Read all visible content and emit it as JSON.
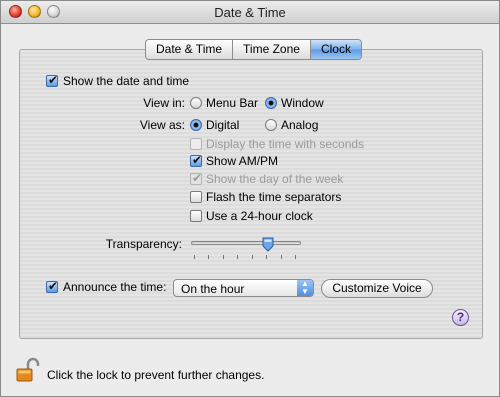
{
  "window": {
    "title": "Date & Time"
  },
  "tabs": [
    {
      "label": "Date & Time",
      "active": false
    },
    {
      "label": "Time Zone",
      "active": false
    },
    {
      "label": "Clock",
      "active": true
    }
  ],
  "clock": {
    "show_date_time": {
      "label": "Show the date and time",
      "checked": true
    },
    "view_in": {
      "label": "View in:",
      "options": [
        {
          "label": "Menu Bar",
          "selected": false
        },
        {
          "label": "Window",
          "selected": true
        }
      ]
    },
    "view_as": {
      "label": "View as:",
      "options": [
        {
          "label": "Digital",
          "selected": true
        },
        {
          "label": "Analog",
          "selected": false
        }
      ]
    },
    "options": [
      {
        "label": "Display the time with seconds",
        "checked": false,
        "enabled": false
      },
      {
        "label": "Show AM/PM",
        "checked": true,
        "enabled": true
      },
      {
        "label": "Show the day of the week",
        "checked": true,
        "enabled": false
      },
      {
        "label": "Flash the time separators",
        "checked": false,
        "enabled": true
      },
      {
        "label": "Use a 24-hour clock",
        "checked": false,
        "enabled": true
      }
    ],
    "transparency": {
      "label": "Transparency:",
      "value_fraction": 0.7
    },
    "announce": {
      "label": "Announce the time:",
      "checked": true,
      "popup_value": "On the hour",
      "customize_button": "Customize Voice"
    }
  },
  "help_button": "?",
  "footer": {
    "lock_text": "Click the lock to prevent further changes."
  },
  "colors": {
    "accent": "#5e9ae6",
    "lock": "#e58a1a"
  }
}
